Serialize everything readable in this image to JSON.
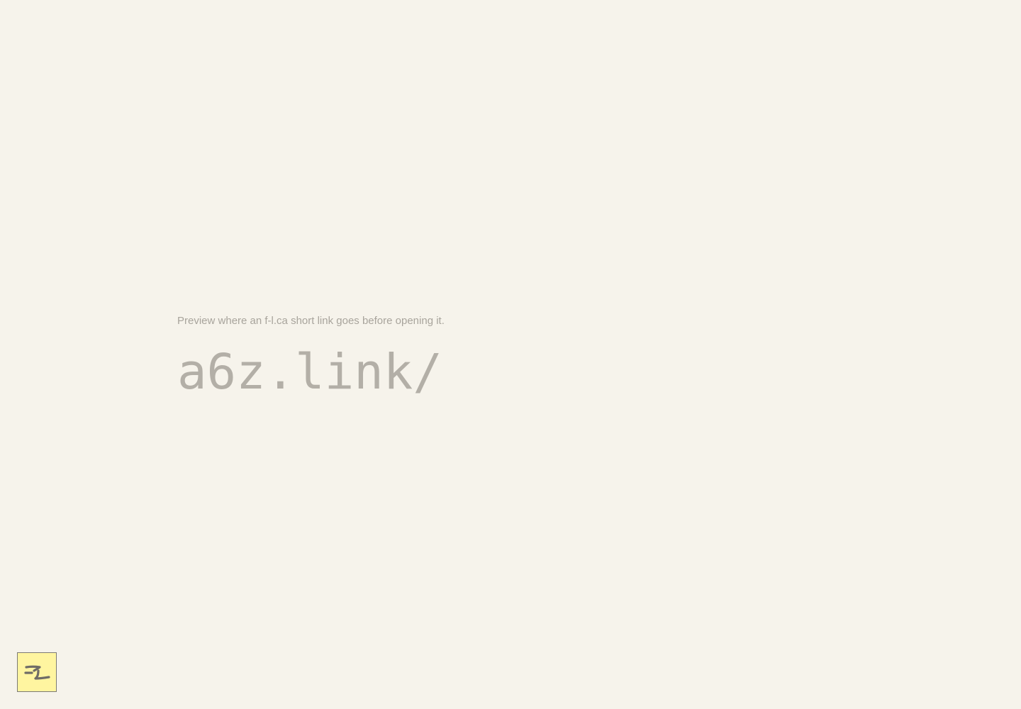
{
  "page": {
    "tagline": "Preview where an f-l.ca short link goes before opening it.",
    "link_prefix": "a6z.link/",
    "link_input_value": ""
  },
  "logo": {
    "icon": "fl-logo-icon",
    "background": "#fff5a0",
    "stroke": "#6f6c66"
  },
  "colors": {
    "background": "#f6f3eb",
    "tagline": "#a8a49c",
    "link_text": "#b3afa7"
  }
}
